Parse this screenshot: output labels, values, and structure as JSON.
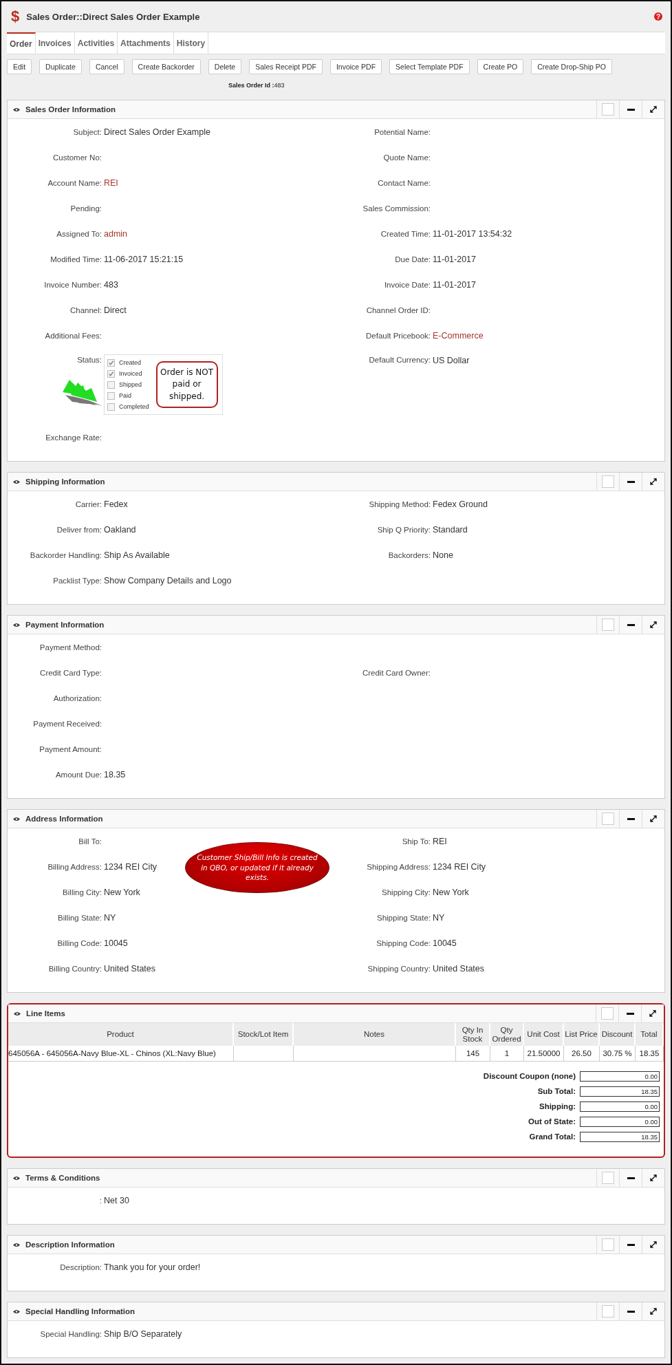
{
  "title_bar": {
    "icon": "$",
    "title": "Sales Order::Direct Sales Order Example",
    "help": "?"
  },
  "tabs": [
    {
      "label": "Order",
      "selected": true
    },
    {
      "label": "Invoices",
      "selected": false
    },
    {
      "label": "Activities",
      "selected": false
    },
    {
      "label": "Attachments",
      "selected": false
    },
    {
      "label": "History",
      "selected": false
    }
  ],
  "buttons": [
    "Edit",
    "Duplicate",
    "Cancel",
    "Create Backorder",
    "Delete",
    "Sales Receipt PDF",
    "Invoice PDF",
    "Select Template PDF",
    "Create PO",
    "Create Drop-Ship PO"
  ],
  "record_id": {
    "label": "Sales Order Id :",
    "value": "483"
  },
  "sections": [
    {
      "kind": "fields",
      "title": "Sales Order Information",
      "checked": false,
      "rows": [
        {
          "left": {
            "label": "Subject:",
            "value": "Direct Sales Order Example"
          },
          "right": {
            "label": "Potential Name:"
          }
        },
        {
          "left": {
            "label": "Customer No:"
          },
          "right": {
            "label": "Quote Name:"
          }
        },
        {
          "left": {
            "label": "Account Name:",
            "value": "REI",
            "link": true
          },
          "right": {
            "label": "Contact Name:"
          }
        },
        {
          "left": {
            "label": "Pending:"
          },
          "right": {
            "label": "Sales Commission:"
          }
        },
        {
          "left": {
            "label": "Assigned To:",
            "value": "admin",
            "link": true
          },
          "right": {
            "label": "Created Time:",
            "value": "11-01-2017 13:54:32"
          }
        },
        {
          "left": {
            "label": "Modified Time:",
            "value": "11-06-2017 15:21:15"
          },
          "right": {
            "label": "Due Date:",
            "value": "11-01-2017"
          }
        },
        {
          "left": {
            "label": "Invoice Number:",
            "value": "483"
          },
          "right": {
            "label": "Invoice Date:",
            "value": "11-01-2017"
          }
        },
        {
          "left": {
            "label": "Channel:",
            "value": "Direct"
          },
          "right": {
            "label": "Channel Order ID:"
          }
        },
        {
          "left": {
            "label": "Additional Fees:"
          },
          "right": {
            "label": "Default Pricebook:",
            "value": "E-Commerce",
            "link": true
          }
        },
        {
          "left": {
            "label": "Status:",
            "kind": "status",
            "options": [
              {
                "label": "Created",
                "checked": true
              },
              {
                "label": "Invoiced",
                "checked": true
              },
              {
                "label": "Shipped",
                "checked": false
              },
              {
                "label": "Paid",
                "checked": false
              },
              {
                "label": "Completed",
                "checked": false
              }
            ],
            "note": "Order is NOT paid or shipped."
          },
          "right": {
            "label": "Default Currency:",
            "value": "US Dollar"
          }
        },
        {
          "left": {
            "label": "Exchange Rate:"
          }
        }
      ]
    },
    {
      "kind": "fields",
      "title": "Shipping Information",
      "checked": false,
      "rows": [
        {
          "left": {
            "label": "Carrier:",
            "value": "Fedex"
          },
          "right": {
            "label": "Shipping Method:",
            "value": "Fedex Ground"
          }
        },
        {
          "left": {
            "label": "Deliver from:",
            "value": "Oakland"
          },
          "right": {
            "label": "Ship Q Priority:",
            "value": "Standard"
          }
        },
        {
          "left": {
            "label": "Backorder Handling:",
            "value": "Ship As Available"
          },
          "right": {
            "label": "Backorders:",
            "value": "None"
          }
        },
        {
          "left": {
            "label": "Packlist Type:",
            "value": "Show Company Details and Logo"
          }
        }
      ]
    },
    {
      "kind": "fields",
      "title": "Payment Information",
      "checked": false,
      "rows": [
        {
          "left": {
            "label": "Payment Method:"
          }
        },
        {
          "left": {
            "label": "Credit Card Type:"
          },
          "right": {
            "label": "Credit Card Owner:"
          }
        },
        {
          "left": {
            "label": "Authorization:"
          }
        },
        {
          "left": {
            "label": "Payment Received:"
          }
        },
        {
          "left": {
            "label": "Payment Amount:"
          }
        },
        {
          "left": {
            "label": "Amount Due:",
            "value": "18.35"
          }
        }
      ]
    },
    {
      "kind": "fields",
      "title": "Address Information",
      "checked": false,
      "note": "Customer Ship/Bill Info is created in QBO, or updated if it already exists.",
      "rows": [
        {
          "left": {
            "label": "Bill To:"
          },
          "right": {
            "label": "Ship To:",
            "value": "REI"
          }
        },
        {
          "left": {
            "label": "Billing Address:",
            "value": "1234 REI City"
          },
          "right": {
            "label": "Shipping Address:",
            "value": "1234 REI City"
          }
        },
        {
          "left": {
            "label": "Billing City:",
            "value": "New York"
          },
          "right": {
            "label": "Shipping City:",
            "value": "New York"
          }
        },
        {
          "left": {
            "label": "Billing State:",
            "value": "NY"
          },
          "right": {
            "label": "Shipping State:",
            "value": "NY"
          }
        },
        {
          "left": {
            "label": "Billing Code:",
            "value": "10045"
          },
          "right": {
            "label": "Shipping Code:",
            "value": "10045"
          }
        },
        {
          "left": {
            "label": "Billing Country:",
            "value": "United States"
          },
          "right": {
            "label": "Shipping Country:",
            "value": "United States"
          }
        }
      ]
    },
    {
      "kind": "line_items",
      "title": "Line Items",
      "checked": false,
      "highlighted": true,
      "columns": [
        "Product",
        "Stock/Lot Item",
        "Notes",
        "Qty In Stock",
        "Qty Ordered",
        "Unit Cost",
        "List Price",
        "Discount",
        "Total"
      ],
      "rows": [
        [
          "645056A - 645056A-Navy Blue-XL - Chinos (XL:Navy Blue)",
          "",
          "",
          "145",
          "1",
          "21.50000",
          "26.50",
          "30.75 %",
          "18.35"
        ]
      ],
      "totals": [
        {
          "label": "Discount Coupon (none)",
          "value": "0.00"
        },
        {
          "label": "Sub Total:",
          "value": "18.35"
        },
        {
          "label": "Shipping:",
          "value": "0.00"
        },
        {
          "label": "Out of State:",
          "value": "0.00"
        },
        {
          "label": "Grand Total:",
          "value": "18.35"
        }
      ]
    },
    {
      "kind": "fields",
      "title": "Terms & Conditions",
      "checked": false,
      "rows": [
        {
          "left": {
            "label": ":",
            "value": "Net 30"
          }
        }
      ]
    },
    {
      "kind": "fields",
      "title": "Description Information",
      "checked": false,
      "rows": [
        {
          "left": {
            "label": "Description:",
            "value": "Thank you for your order!"
          }
        }
      ]
    },
    {
      "kind": "fields",
      "title": "Special Handling Information",
      "checked": false,
      "rows": [
        {
          "left": {
            "label": "Special Handling:",
            "value": "Ship B/O Separately"
          }
        }
      ]
    }
  ]
}
